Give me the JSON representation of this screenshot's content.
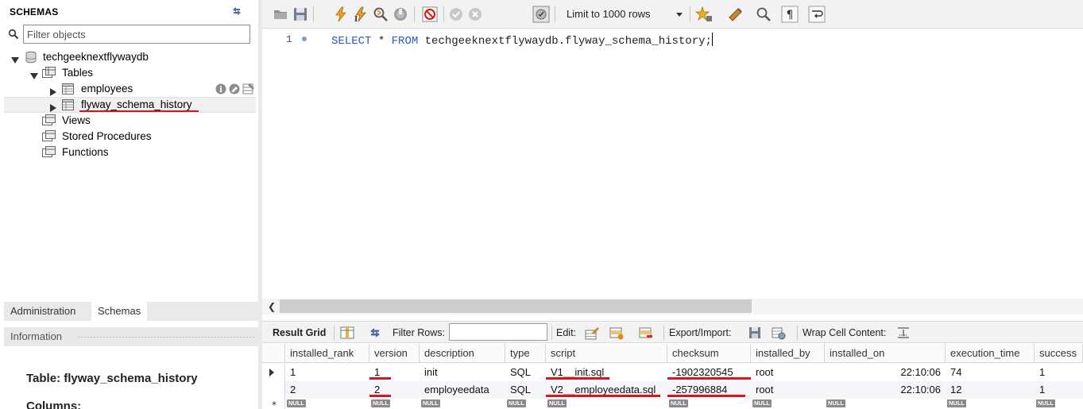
{
  "sidebar": {
    "title": "SCHEMAS",
    "filter_placeholder": "Filter objects",
    "schema_name": "techgeeknextflywaydb",
    "tables_label": "Tables",
    "table_1": "employees",
    "table_2": "flyway_schema_history",
    "views_label": "Views",
    "procedures_label": "Stored Procedures",
    "functions_label": "Functions",
    "tabs": {
      "administration": "Administration",
      "schemas": "Schemas"
    },
    "info_label": "Information",
    "info_table": "Table: flyway_schema_history",
    "info_columns": "Columns:"
  },
  "toolbar": {
    "limit_label": "Limit to 1000 rows"
  },
  "editor": {
    "line_number": "1",
    "kw_select": "SELECT",
    "star": " * ",
    "kw_from": "FROM",
    "table_ref": " techgeeknextflywaydb.flyway_schema_history;"
  },
  "result_toolbar": {
    "result_grid": "Result Grid",
    "filter_rows": "Filter Rows:",
    "edit": "Edit:",
    "export_import": "Export/Import:",
    "wrap_cell": "Wrap Cell Content:"
  },
  "grid": {
    "columns": [
      "installed_rank",
      "version",
      "description",
      "type",
      "script",
      "checksum",
      "installed_by",
      "installed_on",
      "execution_time",
      "success"
    ],
    "rows": [
      [
        "1",
        "1",
        "init",
        "SQL",
        "V1__init.sql",
        "-1902320545",
        "root",
        "22:10:06",
        "74",
        "1"
      ],
      [
        "2",
        "2",
        "employeedata",
        "SQL",
        "V2__employeedata.sql",
        "-257996884",
        "root",
        "22:10:06",
        "12",
        "1"
      ]
    ],
    "null_label": "NULL"
  },
  "colors": {
    "keyword": "#2657c5",
    "annotation_underline": "#d9141c"
  }
}
